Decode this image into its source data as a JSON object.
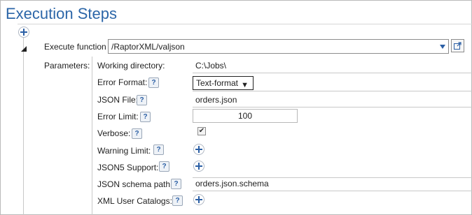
{
  "page": {
    "title": "Execution Steps"
  },
  "step": {
    "execute_function_label": "Execute function",
    "function_value": "/RaptorXML/valjson",
    "parameters_label": "Parameters:"
  },
  "parameters": {
    "working_directory": {
      "label": "Working directory:",
      "value": "C:\\Jobs\\"
    },
    "error_format": {
      "label": "Error Format:",
      "help": "?",
      "value": "Text-format",
      "arrow": "▼"
    },
    "json_file": {
      "label": "JSON File:",
      "help": "?",
      "value": "orders.json"
    },
    "error_limit": {
      "label": "Error Limit:",
      "help": "?",
      "value": "100"
    },
    "verbose": {
      "label": "Verbose:",
      "help": "?",
      "checked": "✔"
    },
    "warning_limit": {
      "label": "Warning Limit:",
      "help": "?"
    },
    "json5_support": {
      "label": "JSON5 Support:",
      "help": "?"
    },
    "json_schema_path": {
      "label": "JSON schema path:",
      "help": "?",
      "value": "orders.json.schema"
    },
    "xml_user_catalogs": {
      "label": "XML User Catalogs:",
      "help": "?"
    }
  },
  "colors": {
    "title": "#2c66a8",
    "accent_icon": "#2b5fa5",
    "border": "#b9b9b9"
  },
  "icons": {
    "add": "plus-icon",
    "collapse": "triangle-collapse-icon",
    "dropdown": "chevron-down-icon",
    "open": "open-external-icon",
    "help": "question-icon"
  }
}
